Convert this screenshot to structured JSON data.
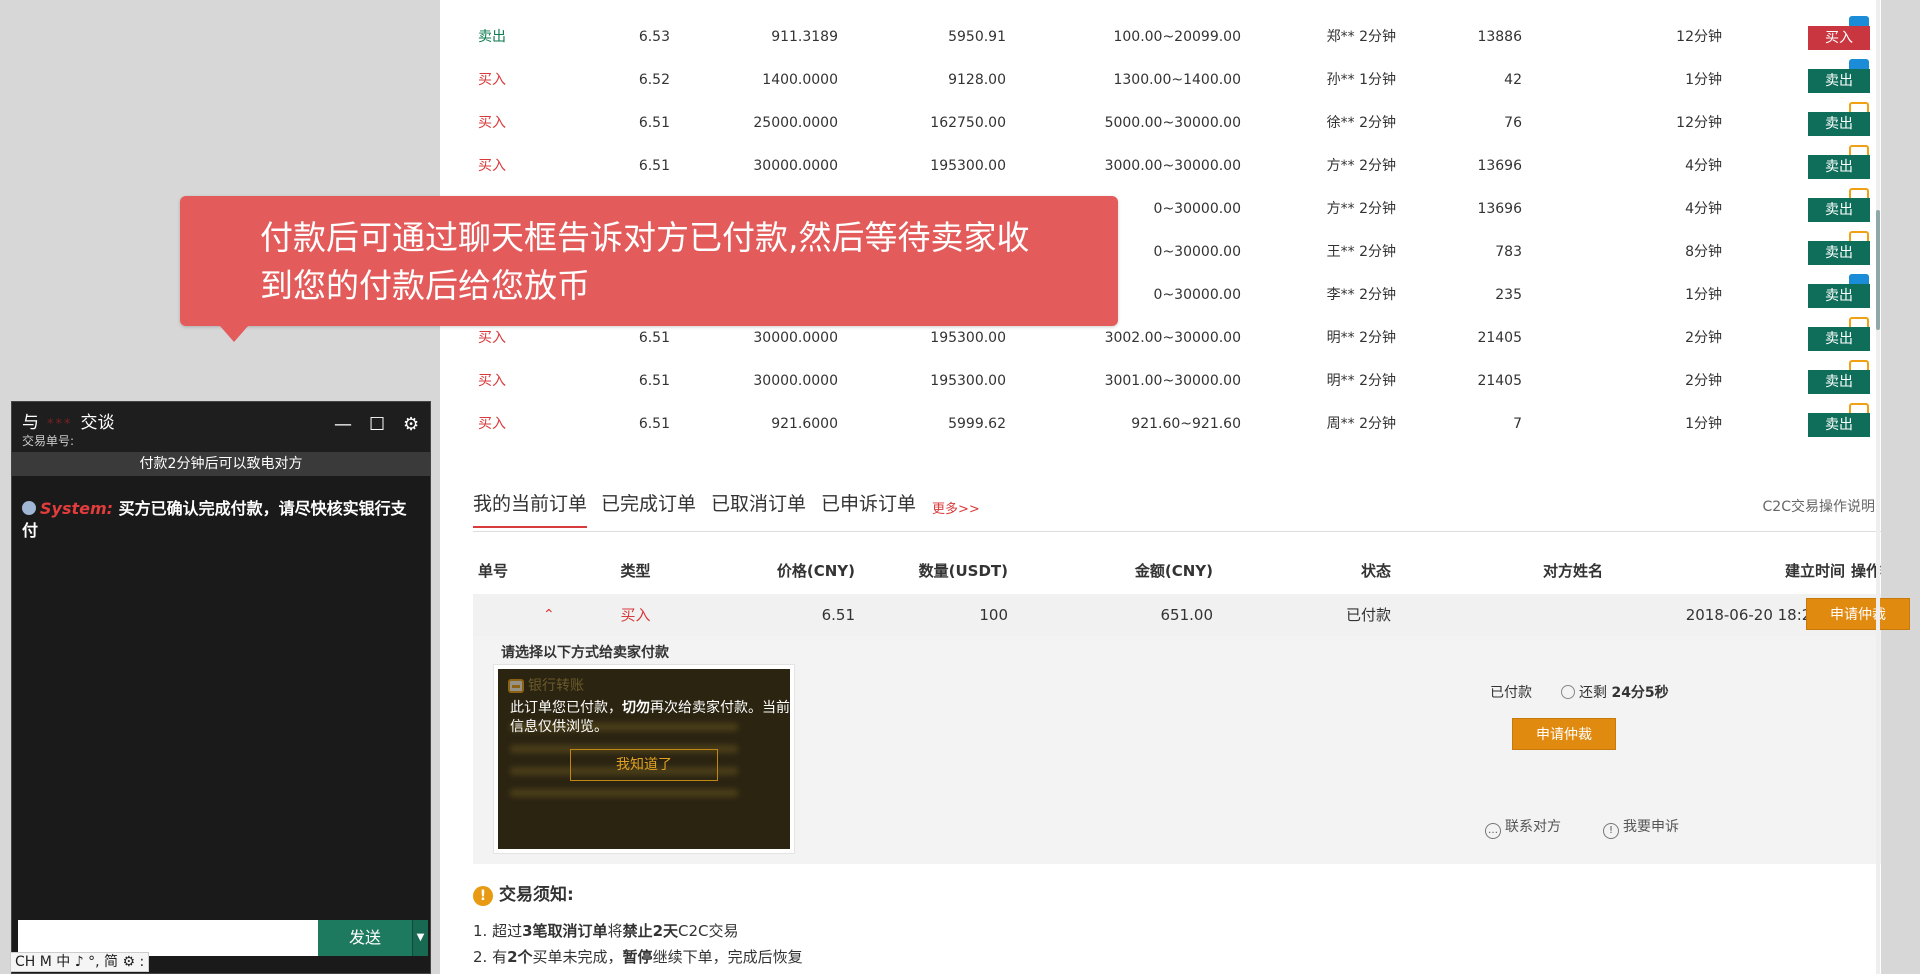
{
  "market_rows": [
    {
      "type": "卖出",
      "type_color": "green",
      "price": "6.53",
      "qty": "911.3189",
      "amount": "5950.91",
      "limit": "100.00~20099.00",
      "user": "郑** 2分钟",
      "count": "13886",
      "time": "12分钟",
      "pay": [
        "alipay"
      ],
      "action": "买入",
      "action_kind": "buy"
    },
    {
      "type": "买入",
      "type_color": "red",
      "price": "6.52",
      "qty": "1400.0000",
      "amount": "9128.00",
      "limit": "1300.00~1400.00",
      "user": "孙** 1分钟",
      "count": "42",
      "time": "1分钟",
      "pay": [
        "alipay"
      ],
      "action": "卖出",
      "action_kind": "sell"
    },
    {
      "type": "买入",
      "type_color": "red",
      "price": "6.51",
      "qty": "25000.0000",
      "amount": "162750.00",
      "limit": "5000.00~30000.00",
      "user": "徐** 2分钟",
      "count": "76",
      "time": "12分钟",
      "pay": [
        "bank"
      ],
      "action": "卖出",
      "action_kind": "sell"
    },
    {
      "type": "买入",
      "type_color": "red",
      "price": "6.51",
      "qty": "30000.0000",
      "amount": "195300.00",
      "limit": "3000.00~30000.00",
      "user": "方** 2分钟",
      "count": "13696",
      "time": "4分钟",
      "pay": [
        "bank"
      ],
      "action": "卖出",
      "action_kind": "sell"
    },
    {
      "type": "",
      "type_color": "red",
      "price": "",
      "qty": "",
      "amount": "",
      "limit": "0~30000.00",
      "user": "方** 2分钟",
      "count": "13696",
      "time": "4分钟",
      "pay": [
        "bank"
      ],
      "action": "卖出",
      "action_kind": "sell"
    },
    {
      "type": "",
      "type_color": "red",
      "price": "",
      "qty": "",
      "amount": "",
      "limit": "0~30000.00",
      "user": "王** 2分钟",
      "count": "783",
      "time": "8分钟",
      "pay": [
        "bank"
      ],
      "action": "卖出",
      "action_kind": "sell"
    },
    {
      "type": "",
      "type_color": "red",
      "price": "",
      "qty": "",
      "amount": "",
      "limit": "0~30000.00",
      "user": "李** 2分钟",
      "count": "235",
      "time": "1分钟",
      "pay": [
        "bank",
        "alipay"
      ],
      "action": "卖出",
      "action_kind": "sell"
    },
    {
      "type": "买入",
      "type_color": "red",
      "price": "6.51",
      "qty": "30000.0000",
      "amount": "195300.00",
      "limit": "3002.00~30000.00",
      "user": "明** 2分钟",
      "count": "21405",
      "time": "2分钟",
      "pay": [
        "bank"
      ],
      "action": "卖出",
      "action_kind": "sell"
    },
    {
      "type": "买入",
      "type_color": "red",
      "price": "6.51",
      "qty": "30000.0000",
      "amount": "195300.00",
      "limit": "3001.00~30000.00",
      "user": "明** 2分钟",
      "count": "21405",
      "time": "2分钟",
      "pay": [
        "bank"
      ],
      "action": "卖出",
      "action_kind": "sell"
    },
    {
      "type": "买入",
      "type_color": "red",
      "price": "6.51",
      "qty": "921.6000",
      "amount": "5999.62",
      "limit": "921.60~921.60",
      "user": "周** 2分钟",
      "count": "7",
      "time": "1分钟",
      "pay": [
        "bank"
      ],
      "action": "卖出",
      "action_kind": "sell"
    }
  ],
  "tabs": {
    "current": "我的当前订单",
    "completed": "已完成订单",
    "cancelled": "已取消订单",
    "appealed": "已申诉订单",
    "more": "更多>>",
    "help": "C2C交易操作说明"
  },
  "orders_header": {
    "id": "单号",
    "type": "类型",
    "price": "价格(CNY)",
    "qty": "数量(USDT)",
    "amount": "金额(CNY)",
    "status": "状态",
    "name": "对方姓名",
    "created": "建立时间",
    "op": "操作"
  },
  "order": {
    "type": "买入",
    "price": "6.51",
    "qty": "100",
    "amount": "651.00",
    "status": "已付款",
    "created": "2018-06-20 18:20:50",
    "op_button": "申请仲裁"
  },
  "detail": {
    "title": "请选择以下方式给卖家付款",
    "bank_title": "银行转账",
    "note_part1": "此订单您已付款，",
    "note_bold": "切勿",
    "note_part2": "再次给卖家付款。当前信息仅供浏览。",
    "ok_button": "我知道了",
    "status": "已付款",
    "countdown_prefix": "还剩",
    "countdown_value": "24分5秒",
    "arbitrate_button": "申请仲裁",
    "contact": "联系对方",
    "complain": "我要申诉"
  },
  "notice": {
    "title": "交易须知:",
    "item1_a": "1. 超过",
    "item1_b": "3笔取消订单",
    "item1_c": "将",
    "item1_d": "禁止2天",
    "item1_e": "C2C交易",
    "item2_a": "2. 有",
    "item2_b": "2个",
    "item2_c": "买单未完成，",
    "item2_d": "暂停",
    "item2_e": "继续下单，完成后恢复"
  },
  "tooltip": {
    "text": "付款后可通过聊天框告诉对方已付款,然后等待卖家收到您的付款后给您放币"
  },
  "chat": {
    "title_prefix": "与",
    "title_masked": "***",
    "title_suffix": "交谈",
    "order_label": "交易单号:",
    "minimize": "—",
    "maximize": "☐",
    "settings": "⚙",
    "banner": "付款2分钟后可以致电对方",
    "system_label": "System:",
    "system_msg": "买方已确认完成付款，请尽快核实银行支付",
    "send": "发送",
    "send_dropdown": "▼"
  },
  "ime": {
    "text": "CH M 中 ♪ °, 简 ⚙ :"
  },
  "colors": {
    "sell_button": "#0f6e5a",
    "buy_button": "#c9363f",
    "tooltip": "#e35b5a",
    "arbitrate": "#e18a10",
    "send_button": "#1e7a5f"
  }
}
